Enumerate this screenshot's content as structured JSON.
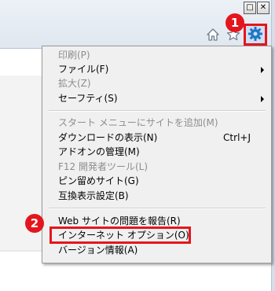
{
  "window": {
    "restore_glyph": "□",
    "close_glyph": "✕"
  },
  "toolbar": {
    "home_icon": "home-icon",
    "favorites_icon": "star-icon",
    "tools_icon": "gear-icon"
  },
  "callouts": {
    "step1": "1",
    "step2": "2",
    "color": "#e4161d"
  },
  "menu": {
    "items": [
      {
        "label": "印刷(P)",
        "disabled": true
      },
      {
        "label": "ファイル(F)",
        "submenu": true
      },
      {
        "label": "拡大(Z)",
        "disabled": true
      },
      {
        "label": "セーフティ(S)",
        "submenu": true
      },
      {
        "label": "スタート メニューにサイトを追加(M)",
        "disabled": true
      },
      {
        "label": "ダウンロードの表示(N)",
        "shortcut": "Ctrl+J"
      },
      {
        "label": "アドオンの管理(M)"
      },
      {
        "label": "F12 開発者ツール(L)",
        "disabled": true
      },
      {
        "label": "ピン留めサイト(G)"
      },
      {
        "label": "互換表示設定(B)"
      },
      {
        "label": "Web サイトの問題を報告(R)"
      },
      {
        "label": "インターネット オプション(O)",
        "highlighted": true
      },
      {
        "label": "バージョン情報(A)"
      }
    ]
  }
}
